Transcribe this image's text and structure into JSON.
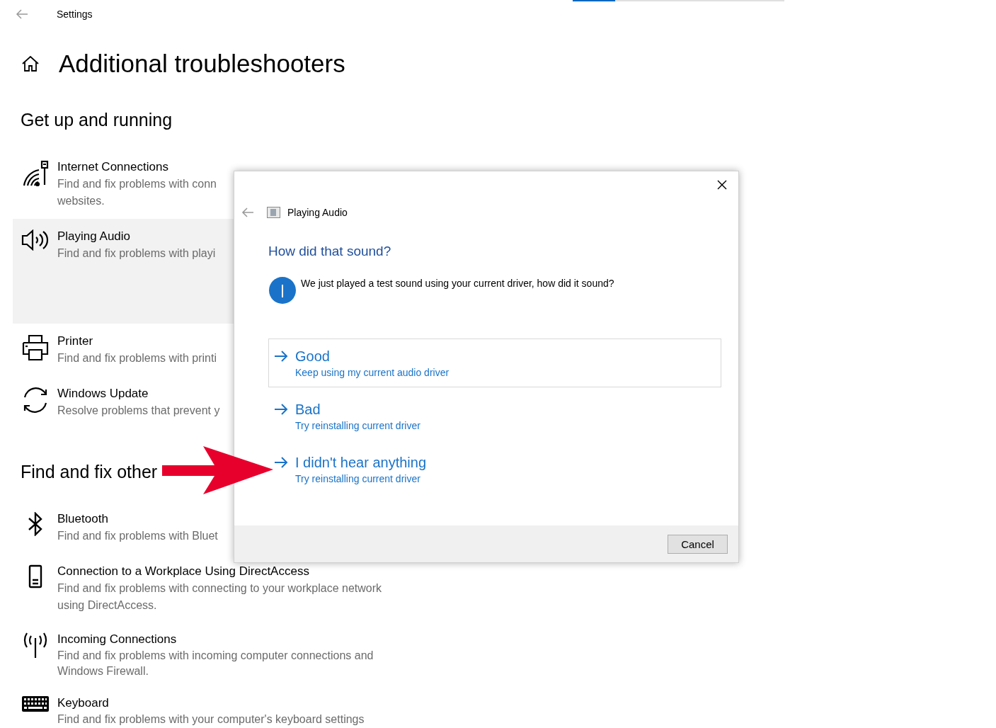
{
  "header": {
    "title": "Settings"
  },
  "progress": {
    "level": 0.2
  },
  "page_title": "Additional troubleshooters",
  "sections": [
    {
      "heading": "Get up and running",
      "items": [
        {
          "title": "Internet Connections",
          "description": "Find and fix problems with conn",
          "description_2": "websites.",
          "selected": false
        },
        {
          "title": "Playing Audio",
          "description": "Find and fix problems with playi",
          "selected": true
        },
        {
          "title": "Printer",
          "description": "Find and fix problems with printi",
          "selected": false
        },
        {
          "title": "Windows Update",
          "description": "Resolve problems that prevent y",
          "selected": false
        }
      ]
    },
    {
      "heading": "Find and fix other",
      "items": [
        {
          "title": "Bluetooth",
          "description": "Find and fix problems with Bluet",
          "selected": false
        },
        {
          "title": "Connection to a Workplace Using DirectAccess",
          "description": "Find and fix problems with connecting to your workplace network using DirectAccess.",
          "selected": false
        },
        {
          "title": "Incoming Connections",
          "description": "Find and fix problems with incoming computer connections and Windows Firewall.",
          "selected": false
        },
        {
          "title": "Keyboard",
          "description": "Find and fix problems with your computer's keyboard settings",
          "selected": false
        }
      ]
    }
  ],
  "dialog": {
    "title": "Playing Audio",
    "question": "How did that sound?",
    "message": "We just played a test sound using your current driver, how did it sound?",
    "options": [
      {
        "label": "Good",
        "detail": "Keep using my current audio driver",
        "selected": true
      },
      {
        "label": "Bad",
        "detail": "Try reinstalling current driver",
        "selected": false
      },
      {
        "label": "I didn't hear anything",
        "detail": "Try reinstalling current driver",
        "selected": false
      }
    ],
    "cancel": "Cancel"
  }
}
